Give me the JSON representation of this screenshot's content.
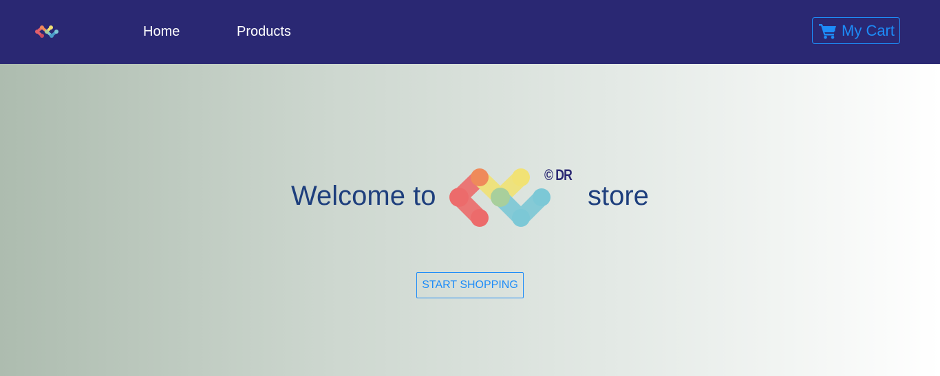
{
  "navbar": {
    "logo_icon": "molecule-logo-icon",
    "links": [
      {
        "label": "Home"
      },
      {
        "label": "Products"
      }
    ],
    "cart": {
      "icon": "shopping-cart-icon",
      "label": "My Cart"
    }
  },
  "hero": {
    "welcome_prefix": "Welcome to",
    "welcome_suffix": "store",
    "logo_icon": "molecule-logo-icon",
    "logo_mark": "© DR",
    "cta_label": "START SHOPPING"
  },
  "colors": {
    "navbar_bg": "#2a2873",
    "accent": "#1d8cf8",
    "heading": "#1e3f7d",
    "logo_red": "#ec6b6b",
    "logo_orange": "#ef8a5a",
    "logo_yellow": "#f1e274",
    "logo_teal": "#7cc8d6",
    "logo_green": "#a8cf9c"
  }
}
